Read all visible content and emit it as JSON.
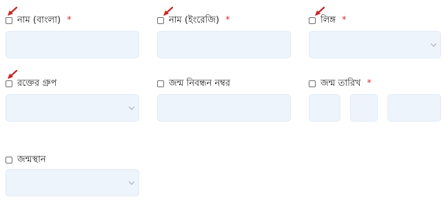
{
  "form": {
    "fields": [
      {
        "label": "নাম (বাংলা)",
        "required_mark": "*"
      },
      {
        "label": "নাম (ইংরেজি)",
        "required_mark": "*"
      },
      {
        "label": "লিঙ্গ",
        "required_mark": "*"
      },
      {
        "label": "রক্তের গ্রুপ"
      },
      {
        "label": "জন্ম নিবন্ধন নম্বর"
      },
      {
        "label": "জন্ম তারিখ",
        "required_mark": "*"
      },
      {
        "label": "জন্মস্থান"
      }
    ]
  },
  "icons": {
    "marker_arrow": "red-arrow-icon",
    "dropdown_caret": "chevron-down-icon"
  },
  "colors": {
    "input_background": "#eef4fb",
    "required": "#d32f2f",
    "marker": "#c62828"
  }
}
